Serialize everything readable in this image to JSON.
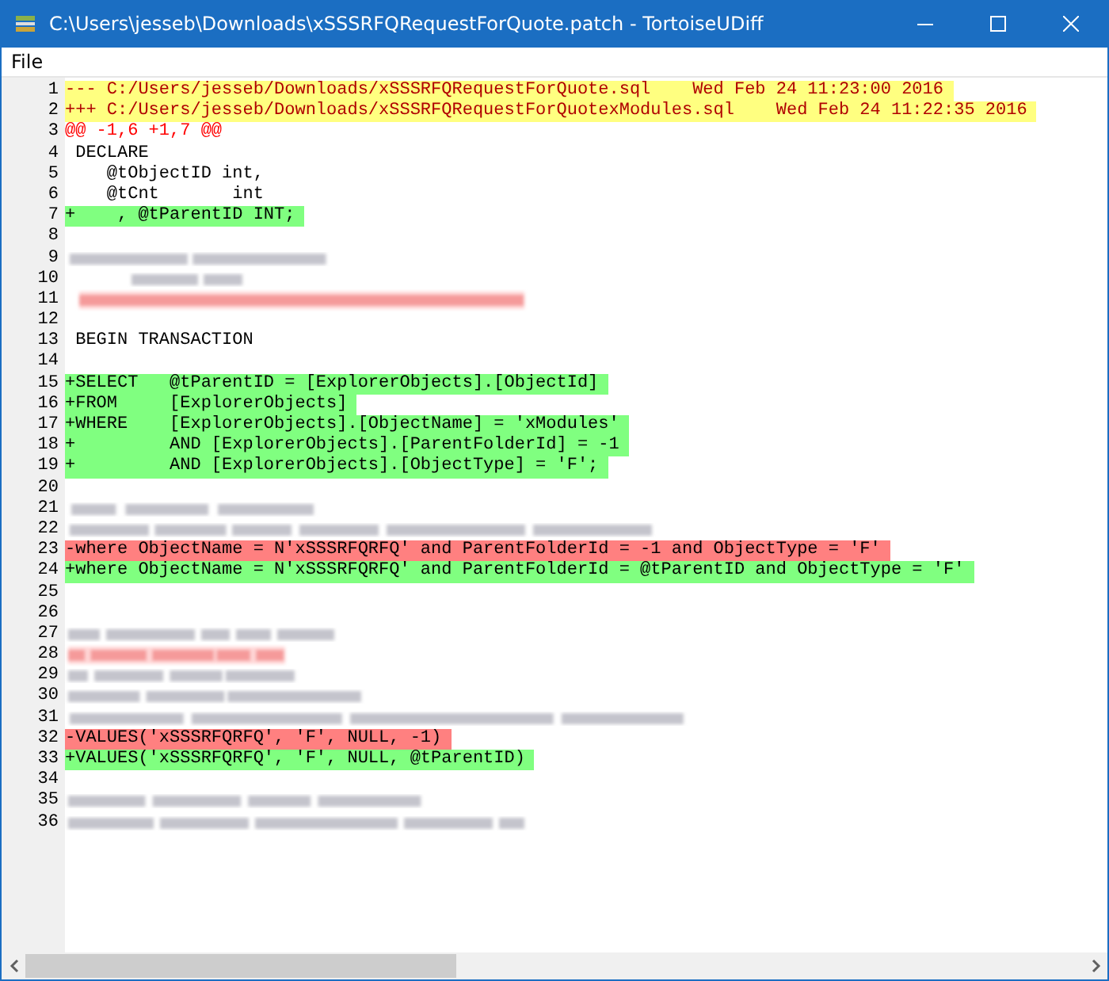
{
  "window": {
    "title": "C:\\Users\\jesseb\\Downloads\\xSSSRFQRequestForQuote.patch - TortoiseUDiff"
  },
  "menu": [
    "File"
  ],
  "lines": [
    {
      "number": "1",
      "kind": "header",
      "text": "--- C:/Users/jesseb/Downloads/xSSSRFQRequestForQuote.sql    Wed Feb 24 11:23:00 2016"
    },
    {
      "number": "2",
      "kind": "header",
      "text": "+++ C:/Users/jesseb/Downloads/xSSSRFQRequestForQuotexModules.sql    Wed Feb 24 11:22:35 2016"
    },
    {
      "number": "3",
      "kind": "hunk",
      "text": "@@ -1,6 +1,7 @@"
    },
    {
      "number": "4",
      "kind": "context",
      "text": " DECLARE"
    },
    {
      "number": "5",
      "kind": "context",
      "text": "    @tObjectID int,"
    },
    {
      "number": "6",
      "kind": "context",
      "text": "    @tCnt       int"
    },
    {
      "number": "7",
      "kind": "added",
      "text": "+    , @tParentID INT;"
    },
    {
      "number": "8",
      "kind": "blank"
    },
    {
      "number": "9",
      "kind": "redacted"
    },
    {
      "number": "10",
      "kind": "redacted"
    },
    {
      "number": "11",
      "kind": "redacted-removed"
    },
    {
      "number": "12",
      "kind": "blank"
    },
    {
      "number": "13",
      "kind": "context",
      "text": " BEGIN TRANSACTION"
    },
    {
      "number": "14",
      "kind": "blank"
    },
    {
      "number": "15",
      "kind": "added",
      "text": "+SELECT   @tParentID = [ExplorerObjects].[ObjectId]"
    },
    {
      "number": "16",
      "kind": "added",
      "text": "+FROM     [ExplorerObjects]"
    },
    {
      "number": "17",
      "kind": "added",
      "text": "+WHERE    [ExplorerObjects].[ObjectName] = 'xModules'"
    },
    {
      "number": "18",
      "kind": "added",
      "text": "+         AND [ExplorerObjects].[ParentFolderId] = -1"
    },
    {
      "number": "19",
      "kind": "added",
      "text": "+         AND [ExplorerObjects].[ObjectType] = 'F';"
    },
    {
      "number": "20",
      "kind": "blank"
    },
    {
      "number": "21",
      "kind": "redacted"
    },
    {
      "number": "22",
      "kind": "redacted"
    },
    {
      "number": "23",
      "kind": "removed",
      "text": "-where ObjectName = N'xSSSRFQRFQ' and ParentFolderId = -1 and ObjectType = 'F'"
    },
    {
      "number": "24",
      "kind": "added",
      "text": "+where ObjectName = N'xSSSRFQRFQ' and ParentFolderId = @tParentID and ObjectType = 'F'"
    },
    {
      "number": "25",
      "kind": "blank"
    },
    {
      "number": "26",
      "kind": "blank"
    },
    {
      "number": "27",
      "kind": "redacted"
    },
    {
      "number": "28",
      "kind": "redacted-removed"
    },
    {
      "number": "29",
      "kind": "redacted"
    },
    {
      "number": "30",
      "kind": "redacted"
    },
    {
      "number": "31",
      "kind": "redacted"
    },
    {
      "number": "32",
      "kind": "removed",
      "text": "-VALUES('xSSSRFQRFQ', 'F', NULL, -1)"
    },
    {
      "number": "33",
      "kind": "added",
      "text": "+VALUES('xSSSRFQRFQ', 'F', NULL, @tParentID)"
    },
    {
      "number": "34",
      "kind": "blank"
    },
    {
      "number": "35",
      "kind": "redacted"
    },
    {
      "number": "36",
      "kind": "redacted"
    }
  ]
}
